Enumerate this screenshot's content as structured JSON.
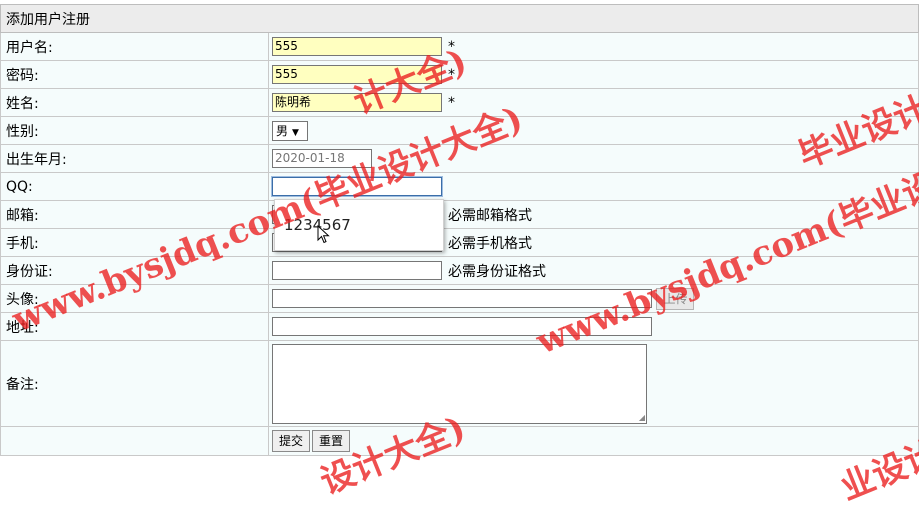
{
  "form": {
    "title": "添加用户注册",
    "fields": {
      "username": {
        "label": "用户名:",
        "value": "555",
        "required": "*"
      },
      "password": {
        "label": "密码:",
        "value": "555",
        "required": "*"
      },
      "name": {
        "label": "姓名:",
        "value": "陈明希",
        "required": "*"
      },
      "gender": {
        "label": "性别:",
        "selected": "男"
      },
      "birth": {
        "label": "出生年月:",
        "value": "2020-01-18"
      },
      "qq": {
        "label": "QQ:",
        "value": ""
      },
      "email": {
        "label": "邮箱:",
        "hint": "必需邮箱格式"
      },
      "phone": {
        "label": "手机:",
        "hint": "必需手机格式"
      },
      "idcard": {
        "label": "身份证:",
        "hint": "必需身份证格式"
      },
      "avatar": {
        "label": "头像:",
        "upload_label": "上传"
      },
      "address": {
        "label": "地址:"
      },
      "remark": {
        "label": "备注:"
      }
    },
    "buttons": {
      "submit": "提交",
      "reset": "重置"
    }
  },
  "autocomplete": {
    "option": "1234567"
  },
  "watermark": {
    "line1": "www.bysjdq.com(毕业设计大全)",
    "line2": "www.bysjdq.com(毕业设计",
    "fragment_top": "计大全)",
    "fragment_bottom": "设计大全)",
    "fragment_right": "毕业设计",
    "fragment_br": "业设计"
  },
  "colors": {
    "required_bg": "#ffffc0",
    "row_bg": "#f5fcfc",
    "header_bg": "#ececec",
    "watermark": "#eb1e1e"
  }
}
